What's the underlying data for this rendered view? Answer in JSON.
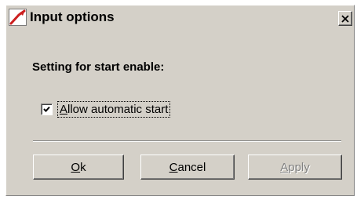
{
  "window": {
    "title": "Input options",
    "close_icon": "close-icon"
  },
  "content": {
    "heading": "Setting for start enable:",
    "checkbox": {
      "label_accel": "A",
      "label_rest": "llow automatic start",
      "checked": true
    }
  },
  "buttons": {
    "ok": {
      "accel": "O",
      "rest": "k"
    },
    "cancel": {
      "accel": "C",
      "rest": "ancel"
    },
    "apply": {
      "accel": "A",
      "rest": "pply",
      "disabled": true
    }
  },
  "colors": {
    "face": "#d4d0c8",
    "disabled_text": "#808080",
    "icon_red": "#cc1f1f"
  }
}
